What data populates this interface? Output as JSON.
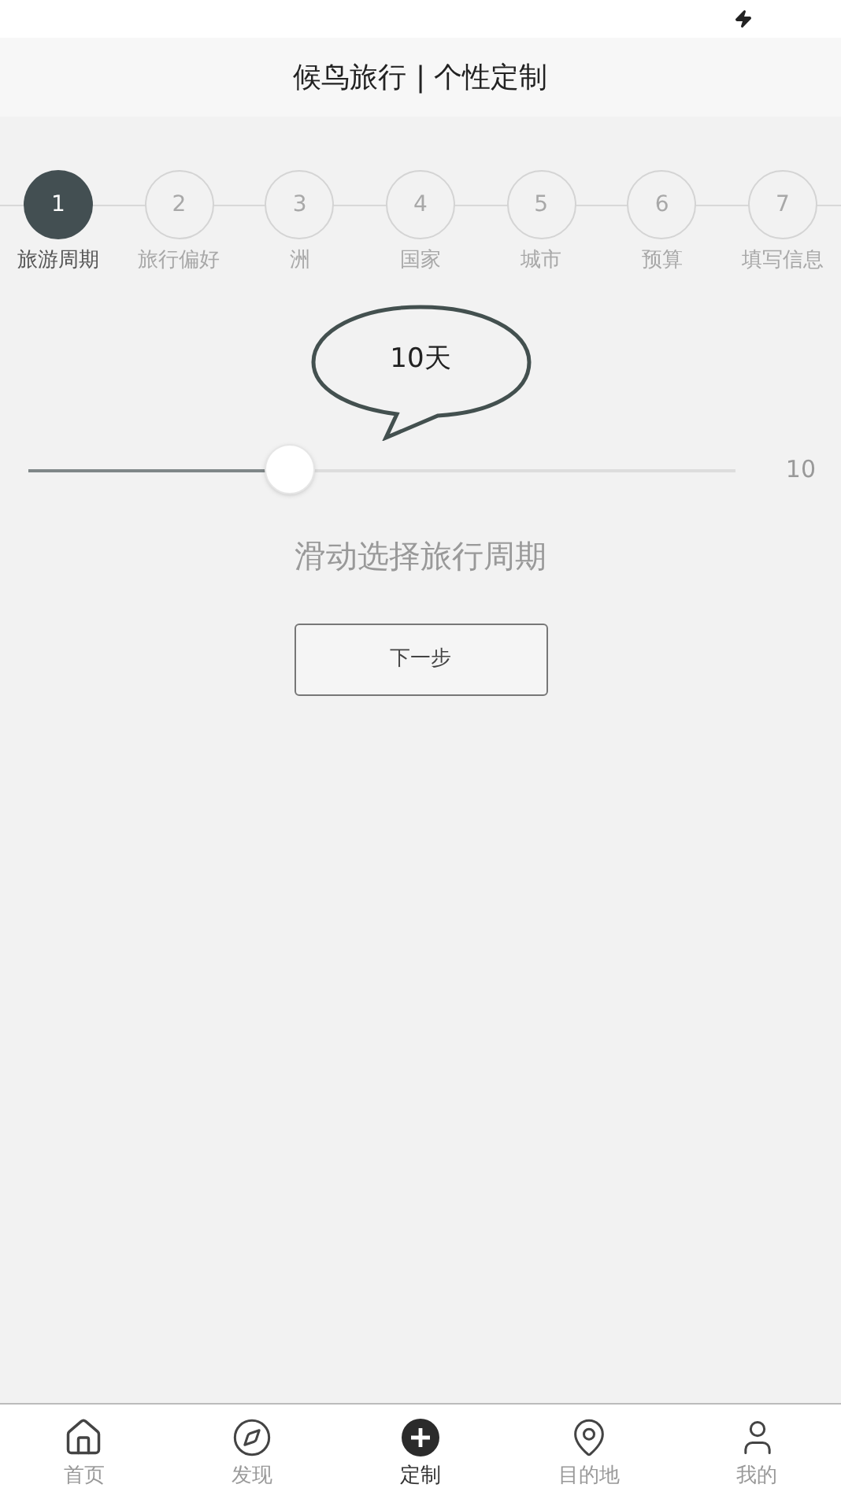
{
  "header": {
    "title": "候鸟旅行 | 个性定制"
  },
  "steps": [
    {
      "number": "1",
      "label": "旅游周期",
      "selected": true
    },
    {
      "number": "2",
      "label": "旅行偏好",
      "selected": false
    },
    {
      "number": "3",
      "label": "洲",
      "selected": false
    },
    {
      "number": "4",
      "label": "国家",
      "selected": false
    },
    {
      "number": "5",
      "label": "城市",
      "selected": false
    },
    {
      "number": "6",
      "label": "预算",
      "selected": false
    },
    {
      "number": "7",
      "label": "填写信息",
      "selected": false
    }
  ],
  "slider": {
    "bubble": "10天",
    "level": 0.37,
    "max_label": "10",
    "hint": "滑动选择旅行周期"
  },
  "next_button": "下一步",
  "tabs": [
    {
      "label": "首页",
      "selected": false
    },
    {
      "label": "发现",
      "selected": false
    },
    {
      "label": "定制",
      "selected": true
    },
    {
      "label": "目的地",
      "selected": false
    },
    {
      "label": "我的",
      "selected": false
    }
  ]
}
